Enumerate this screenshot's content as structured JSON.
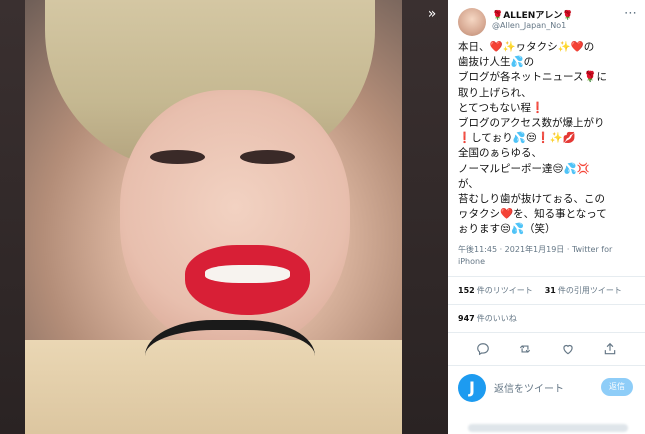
{
  "media": {
    "expand_label": "»"
  },
  "tweet": {
    "author_name": "🌹ALLENアレン🌹",
    "author_handle": "@Allen_Japan_No1",
    "more_label": "⋯",
    "text": "本日、❤️✨ヮタクシ✨❤️の\n歯抜け人生💦の\nブログが各ネットニュース🌹に\n取り上げられ、\nとてつもない程❗\nブログのアクセス数が爆上がり\n❗してぉり💦😒❗✨💋\n全国のぁらゆる、\nノーマルピーポー達😒💦💢\nが、\n苔むしり歯が抜けてぉる、この\nヮタクシ❤️を、知る事となって\nぉります😒💦（笑）",
    "timestamp": "午後11:45 · 2021年1月19日 · Twitter for iPhone",
    "retweets_count": "152",
    "retweets_label": "件のリツイート",
    "quotes_count": "31",
    "quotes_label": "件の引用ツイート",
    "likes_count": "947",
    "likes_label": "件のいいね"
  },
  "reply": {
    "avatar_letter": "J",
    "placeholder": "返信をツイート",
    "button_label": "返信"
  },
  "colors": {
    "accent": "#1d9bf0",
    "muted": "#657786",
    "lips": "#d81f36"
  }
}
